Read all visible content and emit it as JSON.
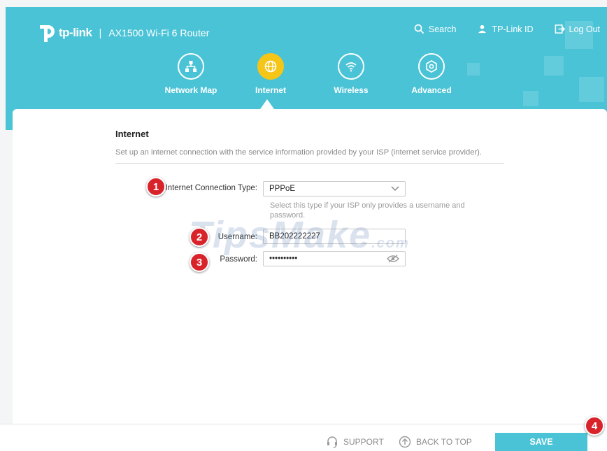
{
  "header": {
    "brand": "tp-link",
    "separator": "|",
    "model": "AX1500 Wi-Fi 6 Router",
    "links": {
      "search": "Search",
      "tplink_id": "TP-Link ID",
      "logout": "Log Out"
    },
    "tabs": [
      {
        "label": "Network Map",
        "icon": "network-map-icon"
      },
      {
        "label": "Internet",
        "icon": "globe-icon",
        "active": true
      },
      {
        "label": "Wireless",
        "icon": "wifi-icon"
      },
      {
        "label": "Advanced",
        "icon": "gear-icon"
      }
    ]
  },
  "internet": {
    "title": "Internet",
    "description": "Set up an internet connection with the service information provided by your ISP (internet service provider).",
    "connection_type_label": "Internet Connection Type:",
    "connection_type_value": "PPPoE",
    "connection_type_hint": "Select this type if your ISP only provides a username and password.",
    "username_label": "Username:",
    "username_value": "BB202222227",
    "password_label": "Password:",
    "password_value": "••••••••••"
  },
  "annotations": {
    "step1": "1",
    "step2": "2",
    "step3": "3",
    "step4": "4"
  },
  "watermark": {
    "main": "TipsMake",
    "suffix": ".com"
  },
  "footer": {
    "support": "SUPPORT",
    "back_to_top": "BACK TO TOP",
    "save": "SAVE"
  },
  "colors": {
    "accent": "#4bc3d6",
    "active_tab": "#f5c518",
    "badge": "#d8232a"
  }
}
